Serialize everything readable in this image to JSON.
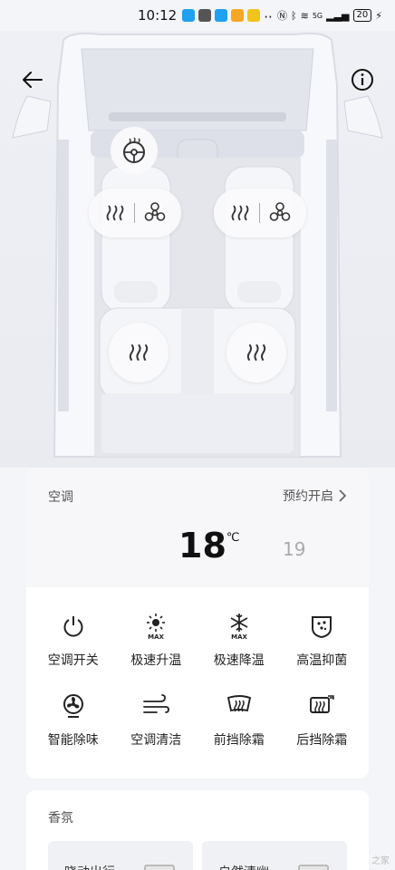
{
  "status_bar": {
    "time": "10:12",
    "network": "5G",
    "battery": "20"
  },
  "car": {
    "front_left": {
      "heat_icon": "seat-heat-icon",
      "fan_icon": "seat-fan-icon"
    },
    "front_right": {
      "heat_icon": "seat-heat-icon",
      "fan_icon": "seat-fan-icon"
    },
    "rear_left": {
      "heat_icon": "seat-heat-icon"
    },
    "rear_right": {
      "heat_icon": "seat-heat-icon"
    }
  },
  "ac": {
    "title": "空调",
    "schedule_label": "预约开启",
    "temperature": "18",
    "temperature_unit": "℃",
    "secondary_temperature": "19",
    "items": [
      {
        "label": "空调开关",
        "icon": "power-icon"
      },
      {
        "label": "极速升温",
        "icon": "sun-max-icon"
      },
      {
        "label": "极速降温",
        "icon": "snowflake-max-icon"
      },
      {
        "label": "高温抑菌",
        "icon": "sterilize-icon"
      },
      {
        "label": "智能除味",
        "icon": "fan-deodorize-icon"
      },
      {
        "label": "空调清洁",
        "icon": "wind-icon"
      },
      {
        "label": "前挡除霜",
        "icon": "front-defrost-icon"
      },
      {
        "label": "后挡除霜",
        "icon": "rear-defrost-icon"
      }
    ]
  },
  "fragrance": {
    "title": "香氛",
    "items": [
      {
        "label": "晓动出行"
      },
      {
        "label": "自然清幽"
      }
    ]
  },
  "watermark": "之家"
}
